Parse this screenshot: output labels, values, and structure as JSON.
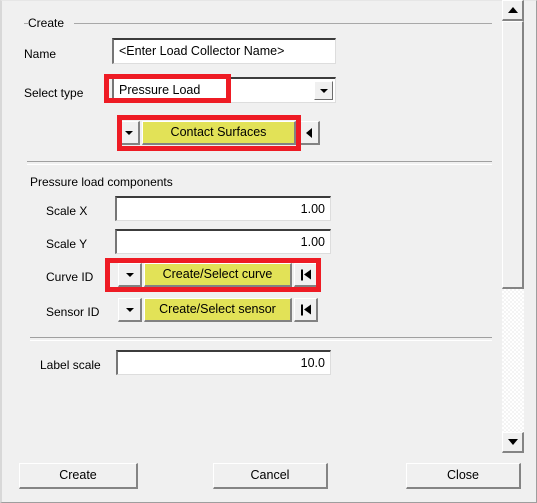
{
  "dialog": {
    "group_title": "Create"
  },
  "fields": {
    "name": {
      "label": "Name",
      "value": "<Enter Load Collector Name>"
    },
    "select_type": {
      "label": "Select type",
      "value": "Pressure Load"
    },
    "entity_selector": {
      "button_label": "Contact Surfaces"
    },
    "components_title": "Pressure load components",
    "scale_x": {
      "label": "Scale X",
      "value": "1.00"
    },
    "scale_y": {
      "label": "Scale Y",
      "value": "1.00"
    },
    "curve_id": {
      "label": "Curve ID",
      "button_label": "Create/Select curve"
    },
    "sensor_id": {
      "label": "Sensor ID",
      "button_label": "Create/Select sensor"
    },
    "label_scale": {
      "label": "Label scale",
      "value": "10.0"
    }
  },
  "buttons": {
    "create": "Create",
    "cancel": "Cancel",
    "close": "Close"
  },
  "colors": {
    "highlight": "#ee1b24",
    "button_yellow": "#e2e257",
    "dialog_face": "#f0f0f0"
  }
}
